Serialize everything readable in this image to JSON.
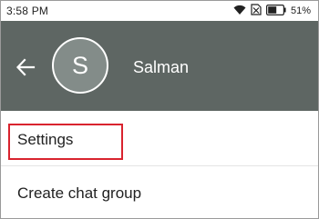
{
  "status_bar": {
    "time": "3:58 PM",
    "battery_percent": "51%",
    "icons": [
      "wifi-icon",
      "no-sim-icon",
      "battery-icon"
    ]
  },
  "header": {
    "back_icon": "back-arrow-icon",
    "avatar_initial": "S",
    "name": "Salman",
    "background_color": "#5e6663"
  },
  "menu": {
    "items": [
      {
        "label": "Settings",
        "highlighted": true
      },
      {
        "label": "Create chat group"
      }
    ]
  },
  "highlight_color": "#d9232e"
}
